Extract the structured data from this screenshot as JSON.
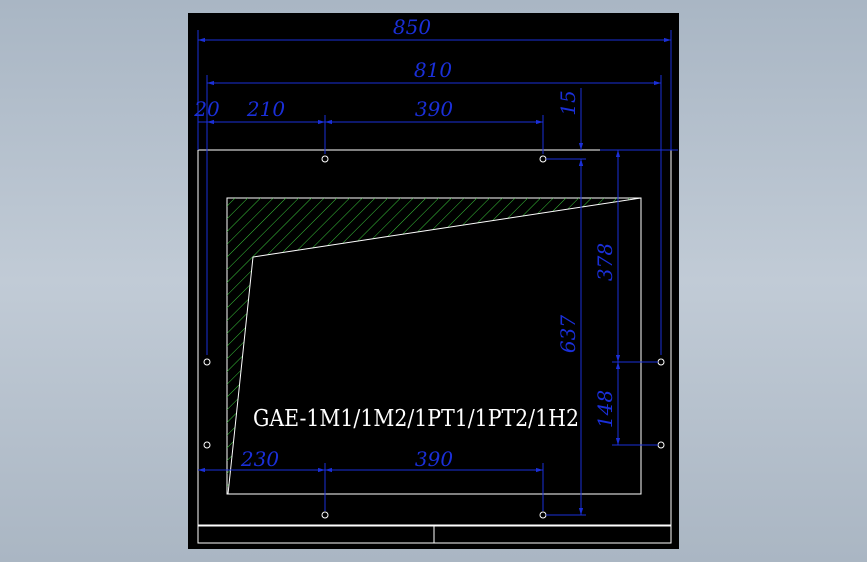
{
  "drawing": {
    "part_label": "GAE-1M1/1M2/1PT1/1PT2/1H2",
    "dimensions": {
      "overall_width": "850",
      "hole_span_width": "810",
      "edge_offset": "20",
      "top_left_offset": "210",
      "top_hole_spacing": "390",
      "top_margin": "15",
      "upper_height": "378",
      "total_height": "637",
      "lower_height": "148",
      "bottom_left_offset": "230",
      "bottom_hole_spacing": "390"
    },
    "colors": {
      "canvas": "#000000",
      "outline": "#ffffff",
      "dimension": "#1a2fd8",
      "hatch": "#39c43a",
      "background": "#b6c2cf"
    }
  }
}
